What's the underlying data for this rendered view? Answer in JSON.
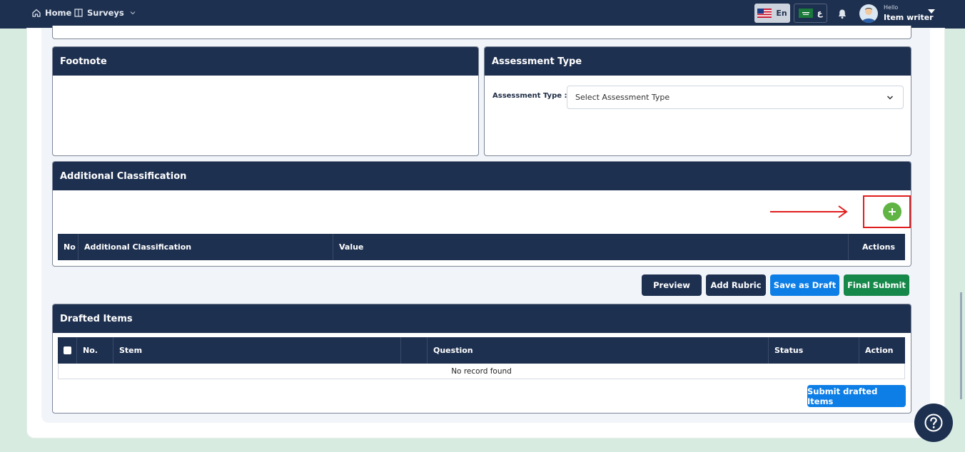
{
  "nav": {
    "home_label": "Home",
    "surveys_label": "Surveys",
    "lang_en_label": "En",
    "lang_ar_label": "ع",
    "hello_label": "Hello",
    "user_name": "Item writer"
  },
  "footnote": {
    "title": "Footnote"
  },
  "assessment": {
    "title": "Assessment Type",
    "label": "Assessment Type :",
    "select_value": "Select Assessment Type"
  },
  "additional_classification": {
    "title": "Additional Classification",
    "columns": [
      "No",
      "Additional Classification",
      "Value",
      "Actions"
    ]
  },
  "actions": {
    "preview": "Preview",
    "add_rubric": "Add Rubric",
    "save_draft": "Save as Draft",
    "final_submit": "Final Submit"
  },
  "drafted": {
    "title": "Drafted Items",
    "columns": [
      "No.",
      "Stem",
      "",
      "Question",
      "Status",
      "Action"
    ],
    "empty_message": "No record found",
    "submit_label": "Submit drafted Items"
  },
  "colors": {
    "navy": "#1e3050",
    "blue": "#0d7ee6",
    "green": "#15884a",
    "add_green": "#5fb443",
    "highlight_red": "#e11d1d"
  }
}
